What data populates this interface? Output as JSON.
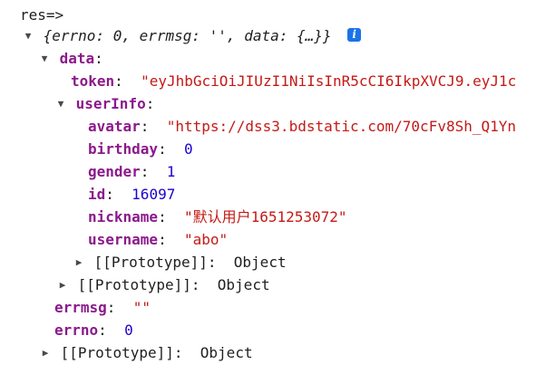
{
  "header": {
    "text": "res=>"
  },
  "root": {
    "summary": "{errno: 0, errmsg: '', data: {…}}",
    "info_icon": "i"
  },
  "data": {
    "key": "data",
    "token": {
      "key": "token",
      "value": "\"eyJhbGciOiJIUzI1NiIsInR5cCI6IkpXVCJ9.eyJ1c"
    },
    "userInfo": {
      "key": "userInfo",
      "avatar": {
        "key": "avatar",
        "value": "\"https://dss3.bdstatic.com/70cFv8Sh_Q1Yn"
      },
      "birthday": {
        "key": "birthday",
        "value": "0"
      },
      "gender": {
        "key": "gender",
        "value": "1"
      },
      "id": {
        "key": "id",
        "value": "16097"
      },
      "nickname": {
        "key": "nickname",
        "value": "\"默认用户1651253072\""
      },
      "username": {
        "key": "username",
        "value": "\"abo\""
      },
      "prototype": {
        "key": "[[Prototype]]",
        "value": "Object"
      }
    },
    "prototype": {
      "key": "[[Prototype]]",
      "value": "Object"
    }
  },
  "errmsg": {
    "key": "errmsg",
    "value": "\"\""
  },
  "errno": {
    "key": "errno",
    "value": "0"
  },
  "prototype": {
    "key": "[[Prototype]]",
    "value": "Object"
  }
}
